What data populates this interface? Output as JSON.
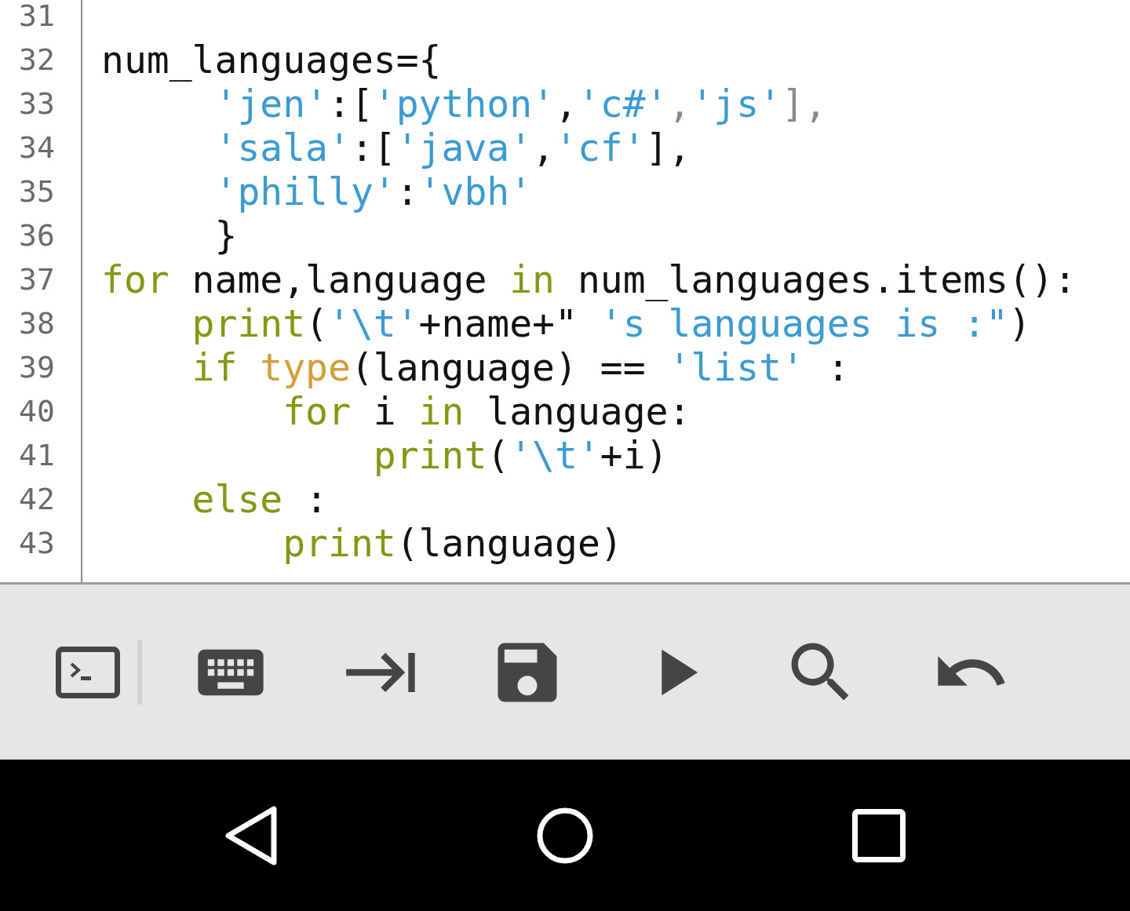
{
  "editor": {
    "lines": [
      {
        "number": "31"
      },
      {
        "number": "32",
        "tokens": [
          {
            "kind": "plain",
            "text": "num_languages={"
          }
        ]
      },
      {
        "number": "33",
        "tokens": [
          {
            "kind": "string",
            "text": "     'jen'"
          },
          {
            "kind": "plain",
            "text": ":["
          },
          {
            "kind": "string",
            "text": "'python'"
          },
          {
            "kind": "plain",
            "text": ","
          },
          {
            "kind": "string",
            "text": "'c#'"
          },
          {
            "kind": "dim",
            "text": ","
          },
          {
            "kind": "string",
            "text": "'js'"
          },
          {
            "kind": "dim",
            "text": "],"
          }
        ]
      },
      {
        "number": "34",
        "tokens": [
          {
            "kind": "string",
            "text": "     'sala'"
          },
          {
            "kind": "plain",
            "text": ":["
          },
          {
            "kind": "string",
            "text": "'java'"
          },
          {
            "kind": "plain",
            "text": ","
          },
          {
            "kind": "string",
            "text": "'cf'"
          },
          {
            "kind": "plain",
            "text": "],"
          }
        ]
      },
      {
        "number": "35",
        "tokens": [
          {
            "kind": "string",
            "text": "     'philly'"
          },
          {
            "kind": "plain",
            "text": ":"
          },
          {
            "kind": "string",
            "text": "'vbh'"
          }
        ]
      },
      {
        "number": "36",
        "tokens": [
          {
            "kind": "plain",
            "text": "     }"
          }
        ]
      },
      {
        "number": "37",
        "tokens": [
          {
            "kind": "keyword",
            "text": "for"
          },
          {
            "kind": "plain",
            "text": " name,language "
          },
          {
            "kind": "keyword",
            "text": "in"
          },
          {
            "kind": "plain",
            "text": " num_languages.items():"
          }
        ]
      },
      {
        "number": "38",
        "tokens": [
          {
            "kind": "keyword",
            "text": "    print"
          },
          {
            "kind": "plain",
            "text": "("
          },
          {
            "kind": "string",
            "text": "'\\t'"
          },
          {
            "kind": "plain",
            "text": "+name+\""
          },
          {
            "kind": "string",
            "text": " 's languages is :\""
          },
          {
            "kind": "plain",
            "text": ")"
          }
        ]
      },
      {
        "number": "39",
        "tokens": [
          {
            "kind": "keyword",
            "text": "    if "
          },
          {
            "kind": "builtin",
            "text": "type"
          },
          {
            "kind": "plain",
            "text": "(language) == "
          },
          {
            "kind": "string",
            "text": "'list'"
          },
          {
            "kind": "plain",
            "text": " :"
          }
        ]
      },
      {
        "number": "40",
        "tokens": [
          {
            "kind": "keyword",
            "text": "        for"
          },
          {
            "kind": "plain",
            "text": " i "
          },
          {
            "kind": "keyword",
            "text": "in"
          },
          {
            "kind": "plain",
            "text": " language:"
          }
        ]
      },
      {
        "number": "41",
        "tokens": [
          {
            "kind": "keyword",
            "text": "            print"
          },
          {
            "kind": "plain",
            "text": "("
          },
          {
            "kind": "string",
            "text": "'\\t'"
          },
          {
            "kind": "plain",
            "text": "+i)"
          }
        ]
      },
      {
        "number": "42",
        "tokens": [
          {
            "kind": "keyword",
            "text": "    else"
          },
          {
            "kind": "plain",
            "text": " :"
          }
        ]
      },
      {
        "number": "43",
        "tokens": [
          {
            "kind": "keyword",
            "text": "        print"
          },
          {
            "kind": "plain",
            "text": "(language)"
          }
        ]
      }
    ]
  }
}
